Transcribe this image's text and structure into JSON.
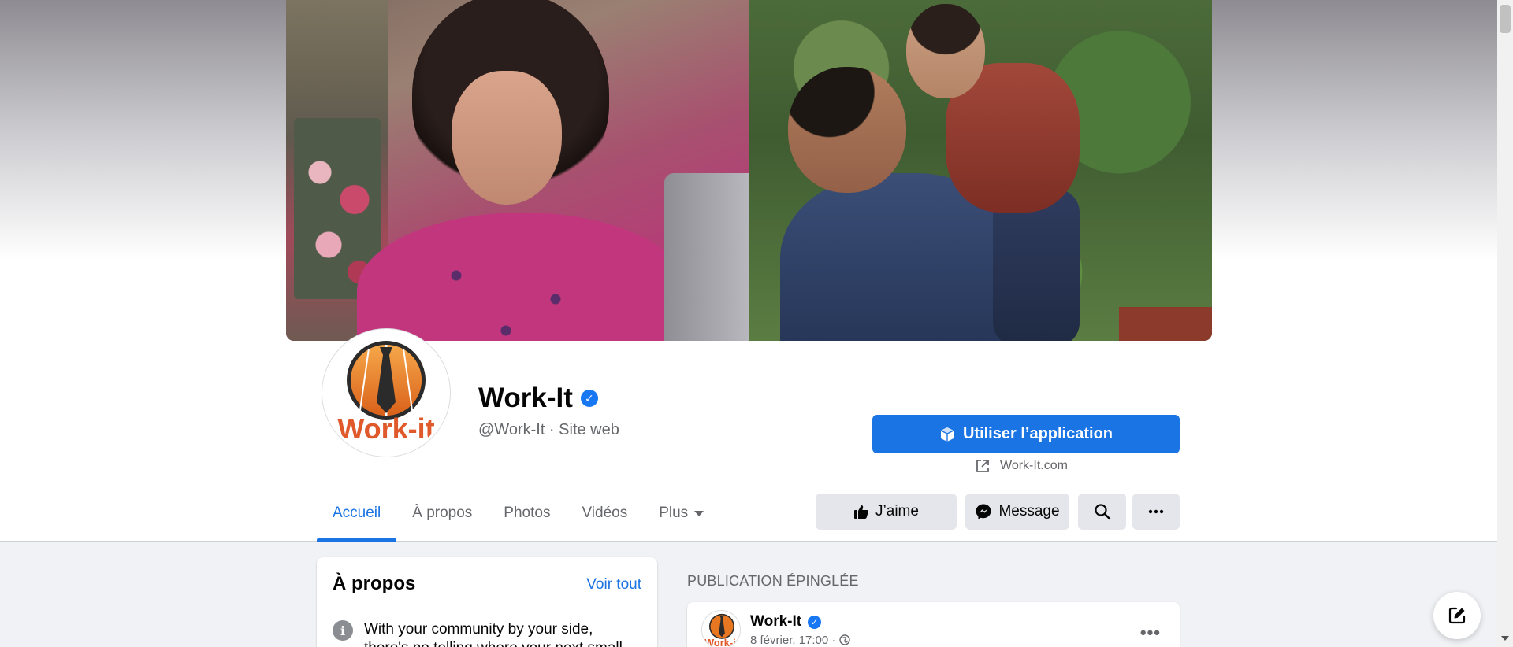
{
  "page": {
    "name": "Work-It",
    "handle": "@Work-It",
    "separator": " · ",
    "category": "Site web",
    "logo_text": "Work-it"
  },
  "cta": {
    "use_app_label": "Utiliser l’application",
    "website": "Work-It.com"
  },
  "tabs": [
    {
      "label": "Accueil",
      "active": true
    },
    {
      "label": "À propos",
      "active": false
    },
    {
      "label": "Photos",
      "active": false
    },
    {
      "label": "Vidéos",
      "active": false
    },
    {
      "label": "Plus",
      "active": false
    }
  ],
  "actions": {
    "like_label": "J’aime",
    "message_label": "Message"
  },
  "about": {
    "title": "À propos",
    "see_all": "Voir tout",
    "text": "With your community by your side, there's no telling where your next small"
  },
  "pinned": {
    "label": "PUBLICATION ÉPINGLÉE",
    "author": "Work-It",
    "date": "8 février, 17:00 ·"
  },
  "colors": {
    "accent": "#1b74e4",
    "logo_orange": "#e87722",
    "logo_dark": "#2b2b2b"
  }
}
